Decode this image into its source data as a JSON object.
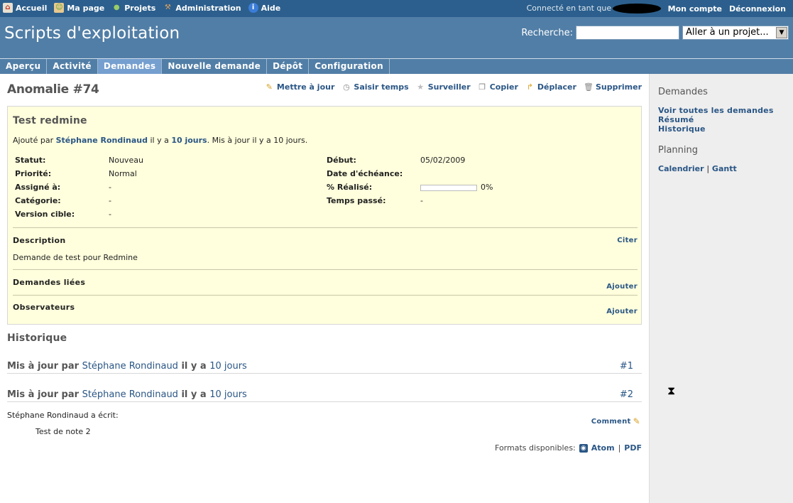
{
  "top_menu": {
    "items": [
      {
        "label": "Accueil",
        "icon": "home-icon"
      },
      {
        "label": "Ma page",
        "icon": "user-page-icon"
      },
      {
        "label": "Projets",
        "icon": "projects-icon"
      },
      {
        "label": "Administration",
        "icon": "hammer-icon"
      },
      {
        "label": "Aide",
        "icon": "info-icon"
      }
    ],
    "logged_as": "Connecté en tant que",
    "my_account": "Mon compte",
    "logout": "Déconnexion"
  },
  "header": {
    "title": "Scripts d'exploitation",
    "search_label": "Recherche:",
    "search_value": "",
    "jump_select": "Aller à un projet..."
  },
  "tabs": [
    {
      "label": "Aperçu"
    },
    {
      "label": "Activité"
    },
    {
      "label": "Demandes"
    },
    {
      "label": "Nouvelle demande"
    },
    {
      "label": "Dépôt"
    },
    {
      "label": "Configuration"
    }
  ],
  "issue": {
    "heading": "Anomalie #74",
    "actions": [
      {
        "label": "Mettre à jour",
        "icon": "pencil-icon"
      },
      {
        "label": "Saisir temps",
        "icon": "clock-icon"
      },
      {
        "label": "Surveiller",
        "icon": "star-icon"
      },
      {
        "label": "Copier",
        "icon": "copy-icon"
      },
      {
        "label": "Déplacer",
        "icon": "move-icon"
      },
      {
        "label": "Supprimer",
        "icon": "trash-icon"
      }
    ],
    "subject": "Test redmine",
    "added_prefix": "Ajouté par ",
    "author": "Stéphane Rondinaud",
    "added_mid": " il y a ",
    "added_age": "10 jours",
    "added_suffix": ". Mis à jour il y a 10 jours.",
    "attributes_left": [
      {
        "key": "Statut:",
        "value": "Nouveau"
      },
      {
        "key": "Priorité:",
        "value": "Normal"
      },
      {
        "key": "Assigné à:",
        "value": "-"
      },
      {
        "key": "Catégorie:",
        "value": "-"
      },
      {
        "key": "Version cible:",
        "value": "-"
      }
    ],
    "attributes_right": [
      {
        "key": "Début:",
        "value": "05/02/2009"
      },
      {
        "key": "Date d'échéance:",
        "value": ""
      },
      {
        "key": "% Réalisé:",
        "value": "0%"
      },
      {
        "key": "Temps passé:",
        "value": "-"
      }
    ],
    "done_ratio": 0,
    "description_title": "Description",
    "quote_label": "Citer",
    "description": "Demande de test pour Redmine",
    "relations_title": "Demandes liées",
    "relations_add": "Ajouter",
    "watchers_title": "Observateurs",
    "watchers_add": "Ajouter"
  },
  "history": {
    "title": "Historique",
    "journals": [
      {
        "prefix": "Mis à jour par ",
        "author": "Stéphane Rondinaud",
        "mid": " il y a ",
        "age": "10 jours",
        "num": "#1"
      },
      {
        "prefix": "Mis à jour par ",
        "author": "Stéphane Rondinaud",
        "mid": " il y a ",
        "age": "10 jours",
        "num": "#2"
      }
    ],
    "note_author": "Stéphane Rondinaud a écrit:",
    "note_body": "Test de note 2",
    "comment_label": "Comment"
  },
  "formats": {
    "label": "Formats disponibles:",
    "atom": "Atom",
    "sep": "|",
    "pdf": "PDF"
  },
  "sidebar": {
    "issues_title": "Demandes",
    "issue_links": [
      "Voir toutes les demandes",
      "Résumé",
      "Historique"
    ],
    "planning_title": "Planning",
    "calendar": "Calendrier",
    "sep": "|",
    "gantt": "Gantt"
  }
}
